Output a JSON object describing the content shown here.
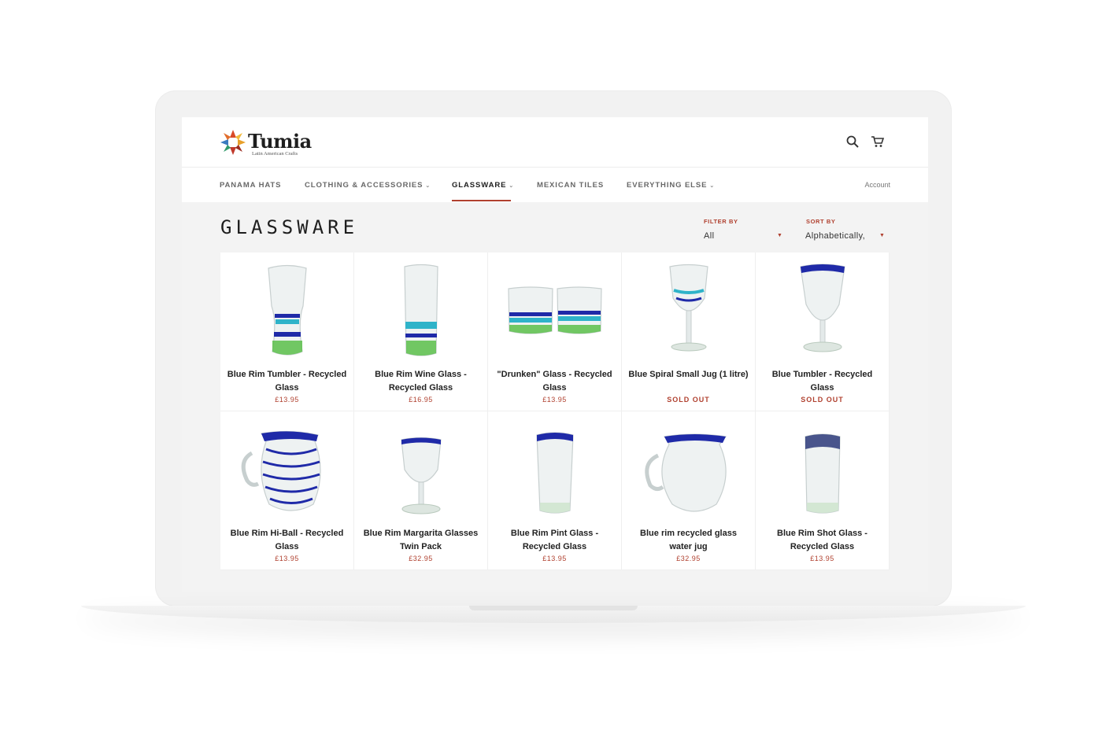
{
  "brand": {
    "name": "Tumia",
    "tagline": "Latin American Crafts"
  },
  "header": {
    "search_icon": "search-icon",
    "cart_icon": "cart-icon"
  },
  "nav": {
    "items": [
      {
        "label": "PANAMA HATS",
        "dropdown": false
      },
      {
        "label": "CLOTHING & ACCESSORIES",
        "dropdown": true
      },
      {
        "label": "GLASSWARE",
        "dropdown": true,
        "active": true
      },
      {
        "label": "MEXICAN TILES",
        "dropdown": false
      },
      {
        "label": "EVERYTHING ELSE",
        "dropdown": true
      }
    ],
    "account": "Account"
  },
  "collection": {
    "title": "GLASSWARE",
    "filter": {
      "label": "FILTER BY",
      "value": "All"
    },
    "sort": {
      "label": "SORT BY",
      "value": "Alphabetically,"
    }
  },
  "products": [
    {
      "name": "Blue Rim Tumbler - Recycled Glass",
      "price": "£13.95",
      "sold_out": false,
      "image": "tumbler-glass"
    },
    {
      "name": "Blue Rim Wine Glass - Recycled Glass",
      "price": "£16.95",
      "sold_out": false,
      "image": "tall-glass"
    },
    {
      "name": "\"Drunken\" Glass - Recycled Glass",
      "price": "£13.95",
      "sold_out": false,
      "image": "two-short-glasses"
    },
    {
      "name": "Blue Spiral Small Jug (1 litre)",
      "price": "SOLD OUT",
      "sold_out": true,
      "image": "stemmed-spiral-glass"
    },
    {
      "name": "Blue Tumbler - Recycled Glass",
      "price": "SOLD OUT",
      "sold_out": true,
      "image": "goblet"
    },
    {
      "name": "Blue Rim Hi-Ball - Recycled Glass",
      "price": "£13.95",
      "sold_out": false,
      "image": "spiral-jug"
    },
    {
      "name": "Blue Rim Margarita Glasses Twin Pack",
      "price": "£32.95",
      "sold_out": false,
      "image": "wine-glass"
    },
    {
      "name": "Blue Rim Pint Glass - Recycled Glass",
      "price": "£13.95",
      "sold_out": false,
      "image": "pint-glass"
    },
    {
      "name": "Blue rim recycled glass water jug",
      "price": "£32.95",
      "sold_out": false,
      "image": "round-jug"
    },
    {
      "name": "Blue Rim Shot Glass - Recycled Glass",
      "price": "£13.95",
      "sold_out": false,
      "image": "shot-glass"
    }
  ],
  "colors": {
    "accent": "#b0402f",
    "rim_blue": "#1f2aa8",
    "turquoise": "#2fb3c9",
    "green": "#5bbf4a"
  }
}
